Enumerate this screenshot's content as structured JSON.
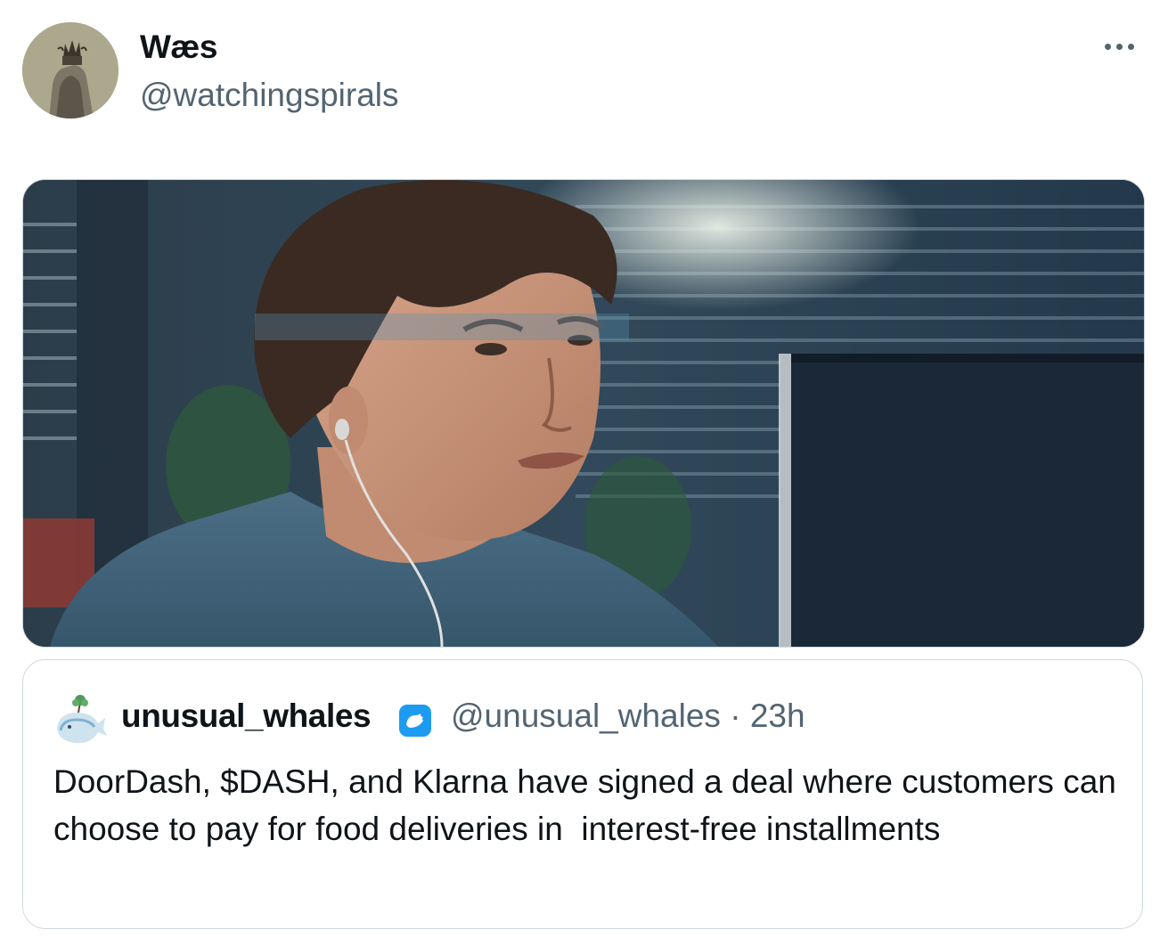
{
  "author": {
    "name": "Wæs",
    "handle": "@watchingspirals"
  },
  "more_menu": {
    "icon": "more-horizontal-icon"
  },
  "media": {
    "kind": "image"
  },
  "quoted_tweet": {
    "name": "unusual_whales",
    "verified": true,
    "handle": "@unusual_whales",
    "separator": "·",
    "time": "23h",
    "text": "DoorDash, $DASH, and Klarna have signed a deal where customers can choose to pay for food deliveries in  interest-free installments"
  },
  "colors": {
    "text_primary": "#0f1419",
    "text_secondary": "#536471",
    "border": "#cfd9de",
    "verified_blue": "#1d9bf0"
  }
}
